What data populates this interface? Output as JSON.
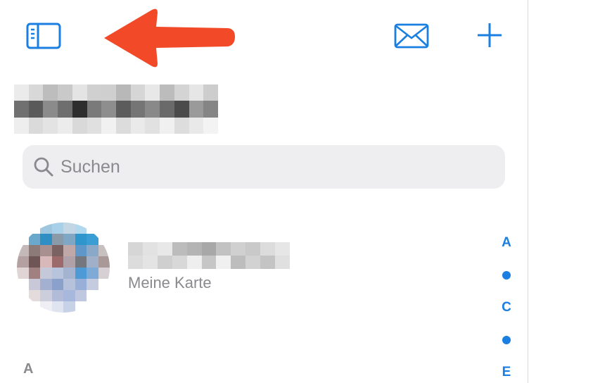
{
  "colors": {
    "accent": "#1a7fe0",
    "annotation_arrow": "#f24a28",
    "search_background": "#eeeef0",
    "secondary_text": "#8a8a8e"
  },
  "toolbar": {
    "left_icon": "sidebar-toggle-icon",
    "right_icons": [
      "envelope-icon",
      "plus-icon"
    ]
  },
  "search": {
    "icon": "magnifying-glass-icon",
    "placeholder": "Suchen",
    "value": ""
  },
  "my_card": {
    "subtitle": "Meine Karte"
  },
  "sections": [
    {
      "header": "A"
    }
  ],
  "index": [
    "A",
    "•",
    "C",
    "•",
    "E"
  ]
}
